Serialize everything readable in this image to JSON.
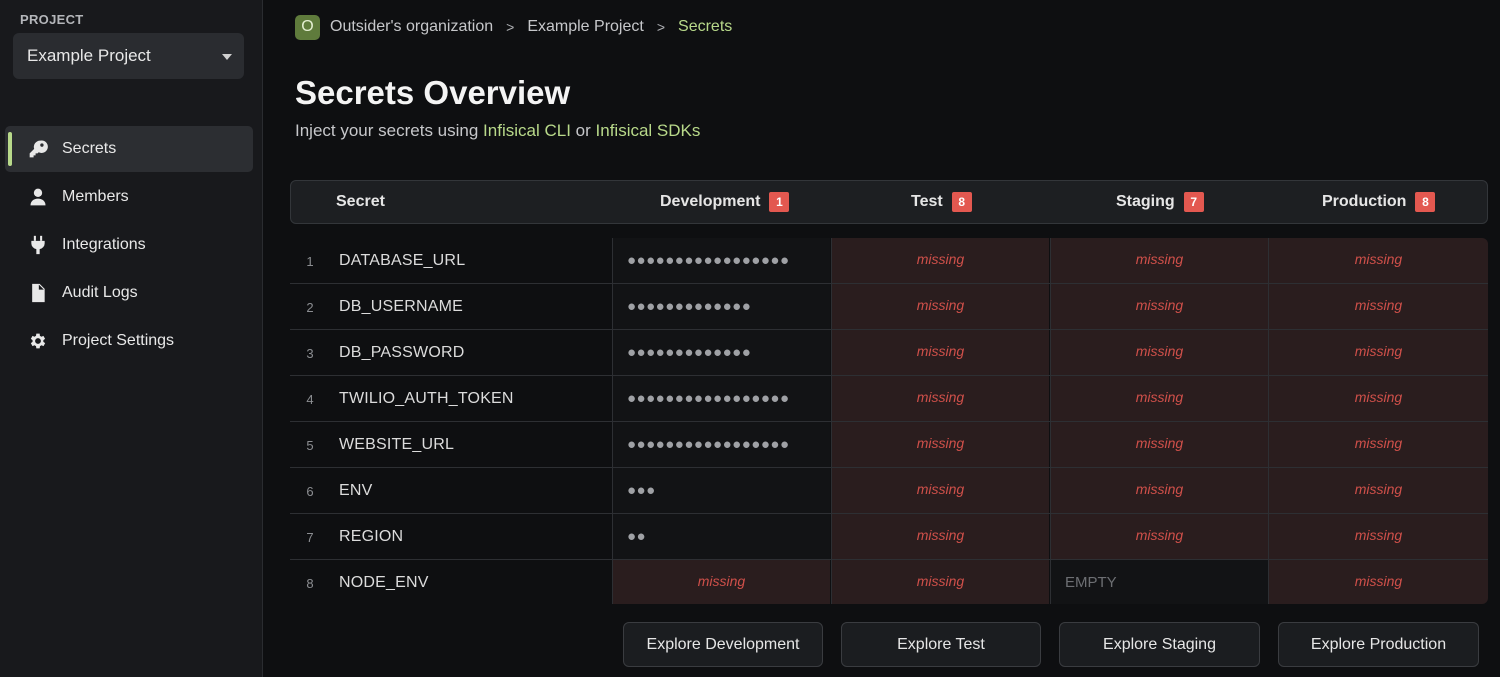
{
  "sidebar": {
    "project_label": "PROJECT",
    "project_selected": "Example Project",
    "items": [
      {
        "label": "Secrets",
        "icon": "key-icon",
        "active": true
      },
      {
        "label": "Members",
        "icon": "user-icon",
        "active": false
      },
      {
        "label": "Integrations",
        "icon": "plug-icon",
        "active": false
      },
      {
        "label": "Audit Logs",
        "icon": "document-icon",
        "active": false
      },
      {
        "label": "Project Settings",
        "icon": "gear-icon",
        "active": false
      }
    ]
  },
  "breadcrumb": {
    "org_initial": "O",
    "org": "Outsider's organization",
    "project": "Example Project",
    "current": "Secrets",
    "separator": ">"
  },
  "header": {
    "title": "Secrets Overview",
    "subtitle_prefix": "Inject your secrets using",
    "link_cli": "Infisical CLI",
    "subtitle_mid": "or",
    "link_sdks": "Infisical SDKs"
  },
  "table": {
    "columns": [
      {
        "label": "Secret"
      },
      {
        "label": "Development",
        "count": "1"
      },
      {
        "label": "Test",
        "count": "8"
      },
      {
        "label": "Staging",
        "count": "7"
      },
      {
        "label": "Production",
        "count": "8"
      }
    ],
    "rows": [
      {
        "num": "1",
        "key": "DATABASE_URL",
        "values": [
          "●●●●●●●●●●●●●●●●●",
          "missing",
          "missing",
          "missing"
        ],
        "states": [
          "masked",
          "missing",
          "missing",
          "missing"
        ]
      },
      {
        "num": "2",
        "key": "DB_USERNAME",
        "values": [
          "●●●●●●●●●●●●●",
          "missing",
          "missing",
          "missing"
        ],
        "states": [
          "masked",
          "missing",
          "missing",
          "missing"
        ]
      },
      {
        "num": "3",
        "key": "DB_PASSWORD",
        "values": [
          "●●●●●●●●●●●●●",
          "missing",
          "missing",
          "missing"
        ],
        "states": [
          "masked",
          "missing",
          "missing",
          "missing"
        ]
      },
      {
        "num": "4",
        "key": "TWILIO_AUTH_TOKEN",
        "values": [
          "●●●●●●●●●●●●●●●●●",
          "missing",
          "missing",
          "missing"
        ],
        "states": [
          "masked",
          "missing",
          "missing",
          "missing"
        ]
      },
      {
        "num": "5",
        "key": "WEBSITE_URL",
        "values": [
          "●●●●●●●●●●●●●●●●●",
          "missing",
          "missing",
          "missing"
        ],
        "states": [
          "masked",
          "missing",
          "missing",
          "missing"
        ]
      },
      {
        "num": "6",
        "key": "ENV",
        "values": [
          "●●●",
          "missing",
          "missing",
          "missing"
        ],
        "states": [
          "masked",
          "missing",
          "missing",
          "missing"
        ]
      },
      {
        "num": "7",
        "key": "REGION",
        "values": [
          "●●",
          "missing",
          "missing",
          "missing"
        ],
        "states": [
          "masked",
          "missing",
          "missing",
          "missing"
        ]
      },
      {
        "num": "8",
        "key": "NODE_ENV",
        "values": [
          "missing",
          "missing",
          "EMPTY",
          "missing"
        ],
        "states": [
          "missing",
          "missing",
          "empty",
          "missing"
        ]
      }
    ]
  },
  "explore_buttons": [
    "Explore Development",
    "Explore Test",
    "Explore Staging",
    "Explore Production"
  ],
  "colors": {
    "accent": "#b8d98a",
    "badge": "#e35850",
    "missing_text": "#d0504a",
    "missing_bg": "#2a1d1e"
  }
}
